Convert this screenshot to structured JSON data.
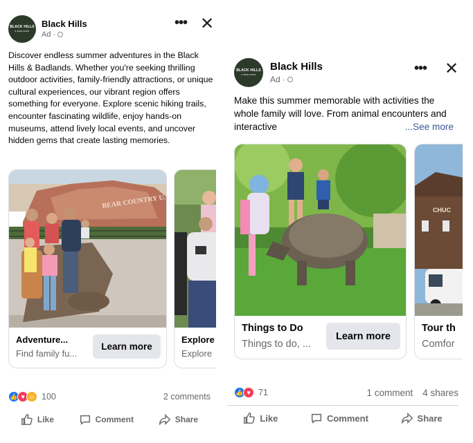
{
  "left_post": {
    "page_name": "Black Hills",
    "sponsored": "Ad ·",
    "avatar_text": "BLACK HILLS",
    "avatar_sub": "& BADLANDS",
    "body": "Discover endless summer adventures in the Black Hills & Badlands. Whether you're seeking thrilling outdoor activities, family-friendly attractions, or unique cultural experiences, our vibrant region offers something for everyone. Explore scenic hiking trails, encounter fascinating wildlife, enjoy hands-on museums, attend lively local events, and uncover hidden gems that create lasting memories.",
    "cards": [
      {
        "title": "Adventure...",
        "subtitle": "Find family fu...",
        "button": "Learn more",
        "sign": "BEAR COUNTRY U.S.A."
      },
      {
        "title": "Explore",
        "subtitle": "Explore"
      }
    ],
    "reaction_count": "100",
    "comments": "2 comments",
    "actions": {
      "like": "Like",
      "comment": "Comment",
      "share": "Share"
    }
  },
  "right_post": {
    "page_name": "Black Hills",
    "sponsored": "Ad ·",
    "avatar_text": "BLACK HILLS",
    "avatar_sub": "& BADLANDS",
    "body": "Make this summer memorable with activities the whole family will love. From animal encounters and interactive",
    "see_more": "...See more",
    "cards": [
      {
        "title": "Things to Do",
        "subtitle": "Things to do, ...",
        "button": "Learn more"
      },
      {
        "title": "Tour th",
        "subtitle": "Comfor",
        "sign": "CHUC"
      }
    ],
    "reaction_count": "71",
    "comments": "1 comment",
    "shares": "4 shares",
    "actions": {
      "like": "Like",
      "comment": "Comment",
      "share": "Share"
    }
  },
  "colors": {
    "link": "#385898",
    "like": "#1877f2",
    "love": "#f33e58",
    "care": "#f7b125",
    "button_bg": "#e4e6eb"
  }
}
